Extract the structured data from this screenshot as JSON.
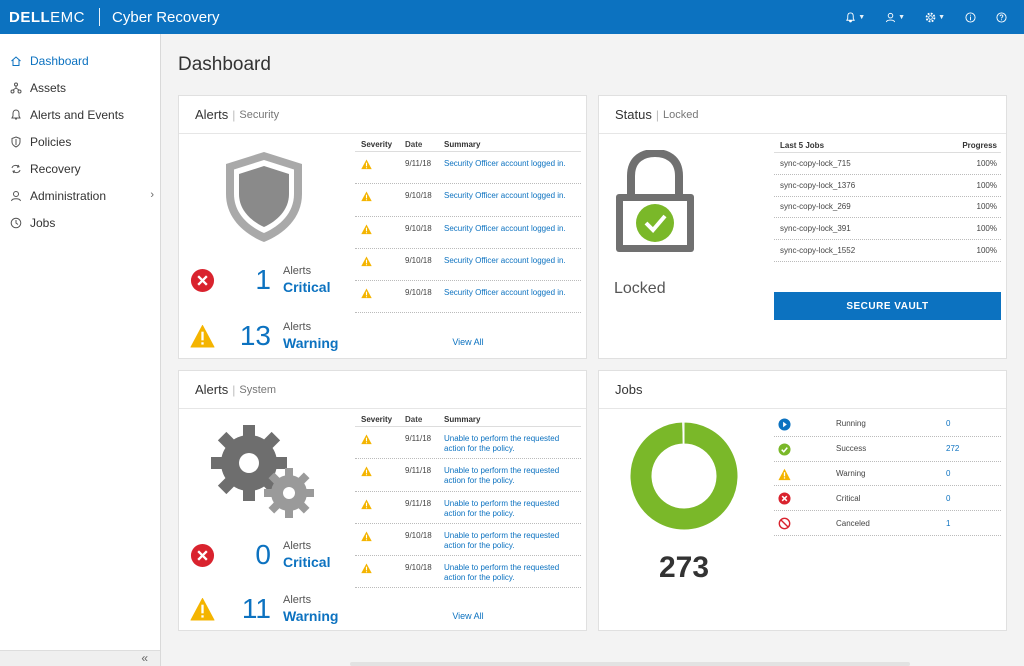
{
  "header": {
    "brand_bold": "DELL",
    "brand_light": "EMC",
    "product": "Cyber Recovery",
    "icons": [
      "bell-icon",
      "user-icon",
      "gear-icon",
      "info-icon",
      "help-icon"
    ]
  },
  "sidebar": {
    "items": [
      {
        "label": "Dashboard",
        "icon": "home-icon",
        "active": true
      },
      {
        "label": "Assets",
        "icon": "assets-icon"
      },
      {
        "label": "Alerts and Events",
        "icon": "bell-icon"
      },
      {
        "label": "Policies",
        "icon": "shield-icon"
      },
      {
        "label": "Recovery",
        "icon": "recovery-icon"
      },
      {
        "label": "Administration",
        "icon": "user-icon"
      },
      {
        "label": "Jobs",
        "icon": "clock-icon"
      }
    ],
    "collapse": "«"
  },
  "page": {
    "title": "Dashboard"
  },
  "alerts_security": {
    "title": "Alerts",
    "subtitle": "Security",
    "critical": {
      "count": "1",
      "label": "Alerts",
      "level": "Critical"
    },
    "warning": {
      "count": "13",
      "label": "Alerts",
      "level": "Warning"
    },
    "columns": [
      "Severity",
      "Date",
      "Summary"
    ],
    "rows": [
      {
        "date": "9/11/18",
        "summary": "Security Officer account logged in."
      },
      {
        "date": "9/10/18",
        "summary": "Security Officer account logged in."
      },
      {
        "date": "9/10/18",
        "summary": "Security Officer account logged in."
      },
      {
        "date": "9/10/18",
        "summary": "Security Officer account logged in."
      },
      {
        "date": "9/10/18",
        "summary": "Security Officer account logged in."
      }
    ],
    "view_all": "View All"
  },
  "alerts_system": {
    "title": "Alerts",
    "subtitle": "System",
    "critical": {
      "count": "0",
      "label": "Alerts",
      "level": "Critical"
    },
    "warning": {
      "count": "11",
      "label": "Alerts",
      "level": "Warning"
    },
    "columns": [
      "Severity",
      "Date",
      "Summary"
    ],
    "rows": [
      {
        "date": "9/11/18",
        "summary": "Unable to perform the requested action for the policy."
      },
      {
        "date": "9/11/18",
        "summary": "Unable to perform the requested action for the policy."
      },
      {
        "date": "9/11/18",
        "summary": "Unable to perform the requested action for the policy."
      },
      {
        "date": "9/10/18",
        "summary": "Unable to perform the requested action for the policy."
      },
      {
        "date": "9/10/18",
        "summary": "Unable to perform the requested action for the policy."
      }
    ],
    "view_all": "View All"
  },
  "status": {
    "title": "Status",
    "subtitle": "Locked",
    "state": "Locked",
    "jobs_header": "Last 5 Jobs",
    "progress_header": "Progress",
    "jobs": [
      {
        "name": "sync-copy-lock_715",
        "progress": "100%"
      },
      {
        "name": "sync-copy-lock_1376",
        "progress": "100%"
      },
      {
        "name": "sync-copy-lock_269",
        "progress": "100%"
      },
      {
        "name": "sync-copy-lock_391",
        "progress": "100%"
      },
      {
        "name": "sync-copy-lock_1552",
        "progress": "100%"
      }
    ],
    "secure_button": "SECURE VAULT"
  },
  "jobs": {
    "title": "Jobs",
    "total": "273",
    "rows": [
      {
        "label": "Running",
        "count": "0",
        "icon": "running-icon"
      },
      {
        "label": "Success",
        "count": "272",
        "icon": "success-icon"
      },
      {
        "label": "Warning",
        "count": "0",
        "icon": "warning-icon"
      },
      {
        "label": "Critical",
        "count": "0",
        "icon": "critical-icon"
      },
      {
        "label": "Canceled",
        "count": "1",
        "icon": "canceled-icon"
      }
    ]
  },
  "colors": {
    "primary": "#0c72c0",
    "success": "#7ab829",
    "warning": "#f4b400",
    "critical": "#d9232e"
  }
}
